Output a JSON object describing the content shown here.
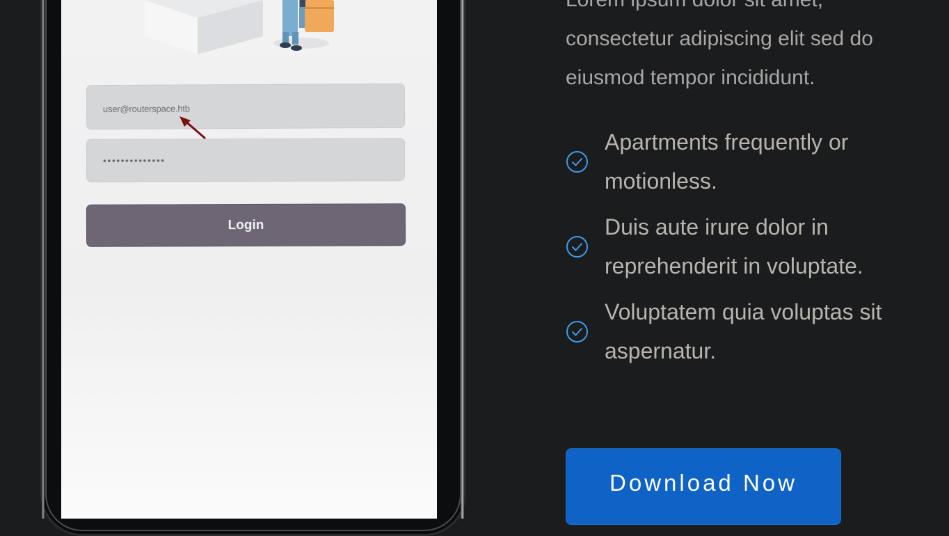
{
  "app_screen": {
    "email_value": "user@routerspace.htb",
    "password_value": "••••••••••••••",
    "login_label": "Login"
  },
  "intro": {
    "line1": "Lorem ipsum dolor sit amet,",
    "line2": "consectetur adipiscing elit sed do",
    "line3": "eiusmod tempor incididunt."
  },
  "features": [
    {
      "line1": "Apartments frequently or",
      "line2": "motionless."
    },
    {
      "line1": "Duis aute irure dolor in",
      "line2": "reprehenderit in voluptate."
    },
    {
      "line1": "Voluptatem quia voluptas sit",
      "line2": "aspernatur."
    }
  ],
  "cta": {
    "download_label": "Download Now"
  },
  "colors": {
    "page_bg": "#1b1c1e",
    "accent_blue": "#0f63c6",
    "check_icon": "#3f9be8",
    "login_button": "#6e6675",
    "pointer_arrow": "#7a0f0f"
  },
  "icons": {
    "feature_check": "check-circle-icon",
    "pointer": "arrow-pointer-icon"
  }
}
